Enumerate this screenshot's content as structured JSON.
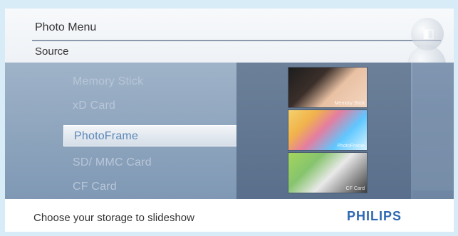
{
  "header": {
    "title": "Photo Menu",
    "subtitle": "Source"
  },
  "sources": {
    "items": [
      {
        "label": "Memory Stick"
      },
      {
        "label": "xD Card"
      },
      {
        "label": "PhotoFrame"
      },
      {
        "label": "SD/ MMC Card"
      },
      {
        "label": "CF Card"
      }
    ],
    "selected_index": 2
  },
  "thumbnails": [
    {
      "caption": "Memory Stick"
    },
    {
      "caption": "PhotoFrame"
    },
    {
      "caption": "CF Card"
    }
  ],
  "footer": {
    "hint": "Choose your storage to slideshow",
    "brand": "PHILIPS"
  },
  "colors": {
    "selected_text": "#5c87b8",
    "brand": "#2d68b2"
  },
  "icons": {
    "top_right_1": "photo-icon",
    "top_right_2": "ring-icon"
  }
}
